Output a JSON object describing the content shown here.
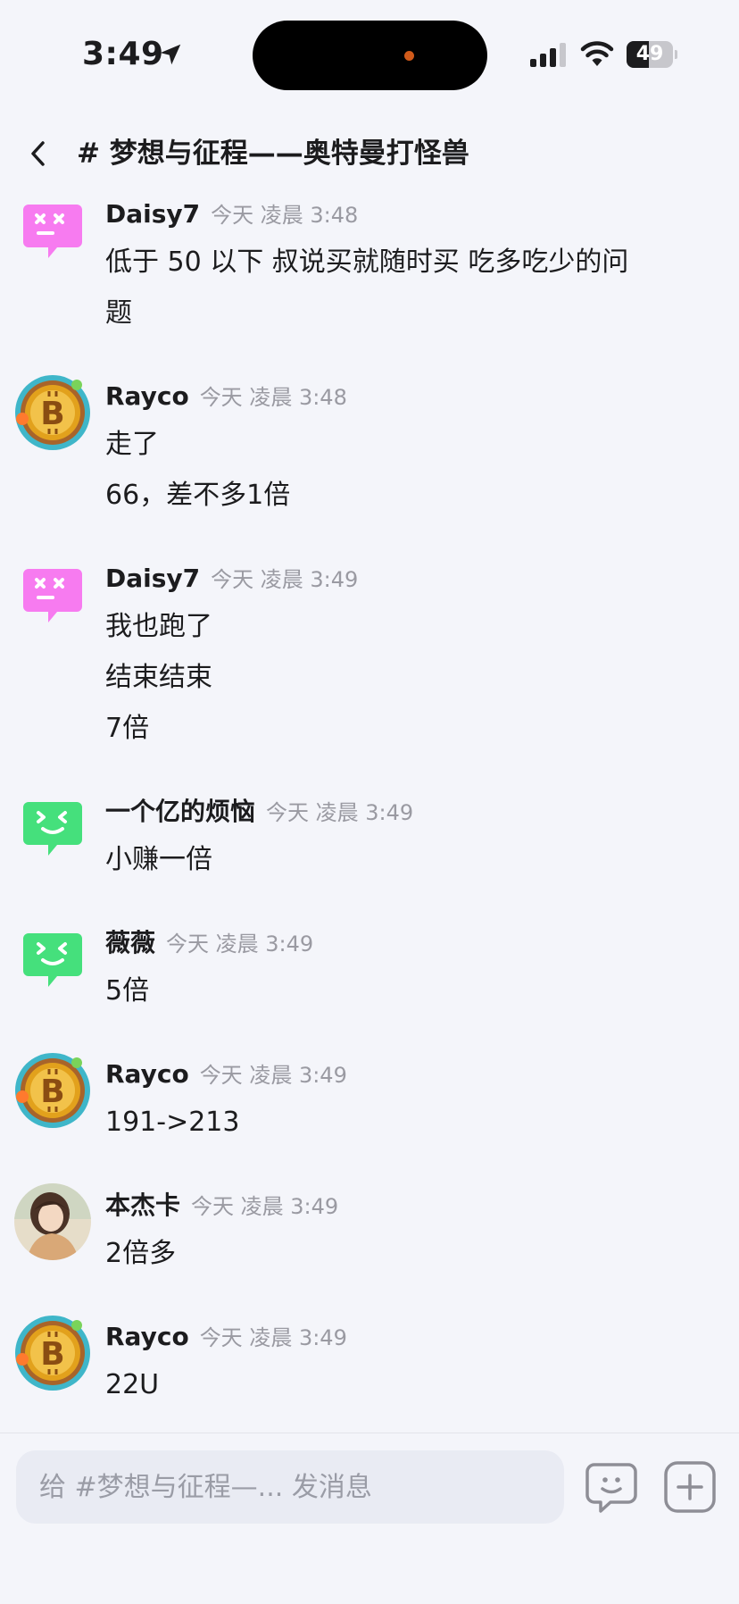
{
  "status_bar": {
    "time": "3:49",
    "battery": "49",
    "battery_level": 0.49
  },
  "header": {
    "title": "# 梦想与征程——奥特曼打怪兽"
  },
  "messages": [
    {
      "author": "Daisy7",
      "time": "今天 凌晨 3:48",
      "avatar": "pink-robot-avatar",
      "lines": [
        "低于 50 以下 叔说买就随时买  吃多吃少的问",
        "题"
      ]
    },
    {
      "author": "Rayco",
      "time": "今天 凌晨 3:48",
      "avatar": "bitcoin-avatar",
      "lines": [
        "走了",
        "66，差不多1倍"
      ]
    },
    {
      "author": "Daisy7",
      "time": "今天 凌晨 3:49",
      "avatar": "pink-robot-avatar",
      "lines": [
        "我也跑了",
        "结束结束",
        "7倍"
      ]
    },
    {
      "author": "一个亿的烦恼",
      "time": "今天 凌晨 3:49",
      "avatar": "green-robot-avatar",
      "lines": [
        "小赚一倍"
      ]
    },
    {
      "author": "薇薇",
      "time": "今天 凌晨 3:49",
      "avatar": "green-robot-avatar",
      "lines": [
        "5倍"
      ]
    },
    {
      "author": "Rayco",
      "time": "今天 凌晨 3:49",
      "avatar": "bitcoin-avatar",
      "lines": [
        "191->213"
      ]
    },
    {
      "author": "本杰卡",
      "time": "今天 凌晨 3:49",
      "avatar": "girl-photo-avatar",
      "lines": [
        "2倍多"
      ]
    },
    {
      "author": "Rayco",
      "time": "今天 凌晨 3:49",
      "avatar": "bitcoin-avatar",
      "lines": [
        "22U"
      ]
    }
  ],
  "input": {
    "placeholder": "给 #梦想与征程—... 发消息"
  },
  "icons": {
    "back": "chevron-left-icon",
    "emoji": "emoji-icon",
    "plus": "plus-icon"
  },
  "colors": {
    "background": "#f4f5fa",
    "pink_avatar": "#f77bf0",
    "green_avatar": "#45e07c",
    "bitcoin_gold": "#e2a11c",
    "muted_text": "#9a9aa2"
  }
}
